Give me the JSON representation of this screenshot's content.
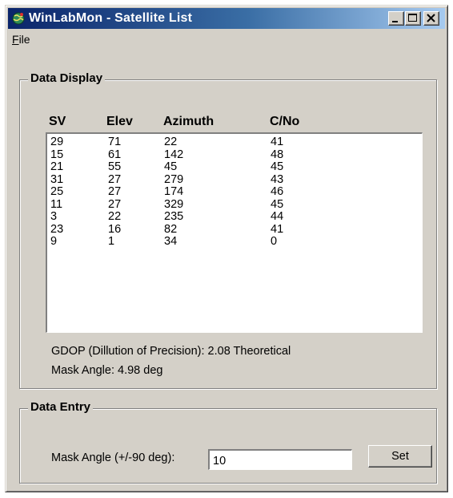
{
  "window": {
    "title": "WinLabMon - Satellite List",
    "buttons": [
      "minimize",
      "maximize",
      "close"
    ]
  },
  "menu": {
    "items": [
      {
        "label": "File",
        "mnemonic": "F"
      }
    ]
  },
  "data_display": {
    "title": "Data Display",
    "columns": [
      "SV",
      "Elev",
      "Azimuth",
      "C/No"
    ],
    "rows": [
      [
        "29",
        "71",
        "22",
        "41"
      ],
      [
        "15",
        "61",
        "142",
        "48"
      ],
      [
        "21",
        "55",
        "45",
        "45"
      ],
      [
        "31",
        "27",
        "279",
        "43"
      ],
      [
        "25",
        "27",
        "174",
        "46"
      ],
      [
        "11",
        "27",
        "329",
        "45"
      ],
      [
        "3",
        "22",
        "235",
        "44"
      ],
      [
        "23",
        "16",
        "82",
        "41"
      ],
      [
        "9",
        "1",
        "34",
        "0"
      ]
    ],
    "gdop_text": "GDOP (Dillution of Precision): 2.08 Theoretical",
    "mask_angle_text": "Mask Angle: 4.98 deg"
  },
  "data_entry": {
    "title": "Data Entry",
    "mask_angle_label": "Mask Angle (+/-90 deg):",
    "mask_angle_value": "10",
    "set_label": "Set"
  },
  "icons": {
    "app": "satellite-globe-icon"
  },
  "colors": {
    "title_bar_start": "#0a246a",
    "title_bar_end": "#a6caf0",
    "face": "#d4d0c8"
  }
}
